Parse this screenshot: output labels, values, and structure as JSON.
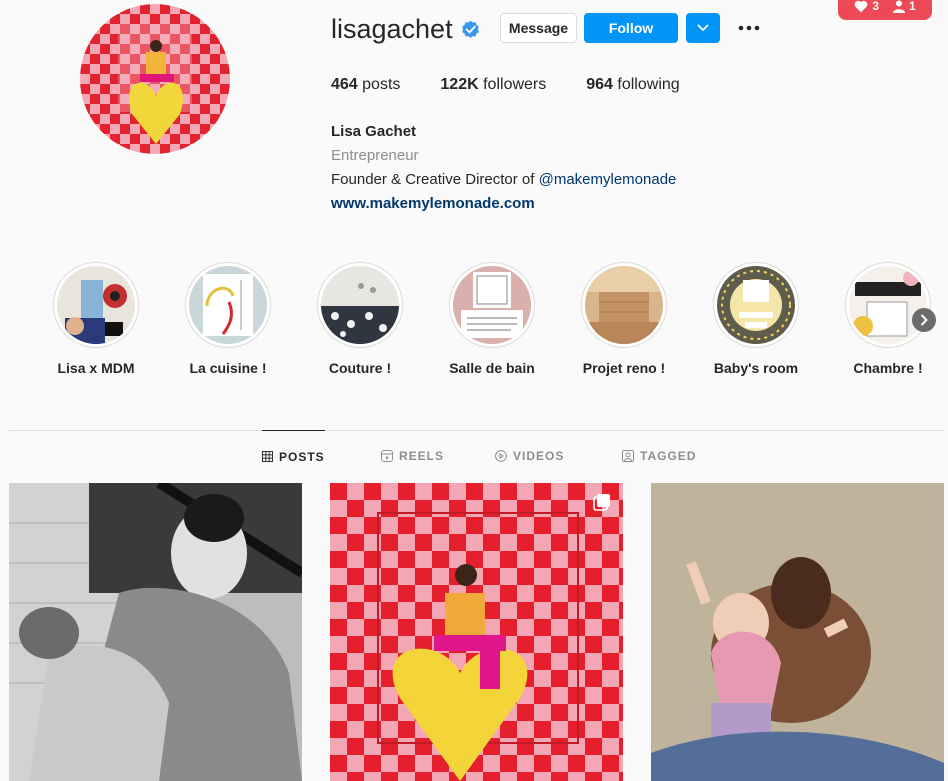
{
  "notifications": {
    "likes": "3",
    "follows": "1"
  },
  "profile": {
    "username": "lisagachet",
    "message_label": "Message",
    "follow_label": "Follow",
    "posts_count": "464",
    "posts_label": "posts",
    "followers_count": "122K",
    "followers_label": "followers",
    "following_count": "964",
    "following_label": "following",
    "full_name": "Lisa Gachet",
    "category": "Entrepreneur",
    "bio_text": "Founder & Creative Director of ",
    "bio_mention": "@makemylemonade",
    "website": "www.makemylemonade.com"
  },
  "highlights": [
    {
      "label": "Lisa x MDM"
    },
    {
      "label": "La cuisine !"
    },
    {
      "label": "Couture !"
    },
    {
      "label": "Salle de bain"
    },
    {
      "label": "Projet reno !"
    },
    {
      "label": "Baby's room"
    },
    {
      "label": "Chambre !"
    }
  ],
  "tabs": [
    {
      "label": "POSTS",
      "active": true
    },
    {
      "label": "REELS",
      "active": false
    },
    {
      "label": "VIDEOS",
      "active": false
    },
    {
      "label": "TAGGED",
      "active": false
    }
  ],
  "colors": {
    "accent": "#0095f6",
    "badge": "#ed4956",
    "link": "#00376b"
  }
}
